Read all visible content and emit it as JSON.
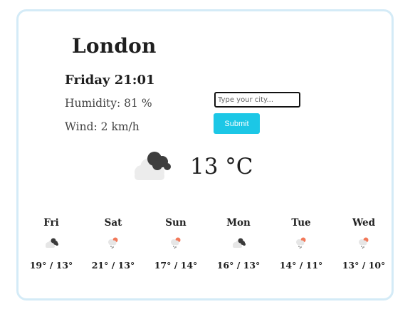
{
  "current": {
    "city": "London",
    "day_time": "Friday 21:01",
    "humidity": "Humidity: 81 %",
    "wind": "Wind: 2 km/h",
    "temperature": "13 °C",
    "icon": "cloudy-night-icon"
  },
  "search": {
    "placeholder": "Type your city...",
    "value": "",
    "submit_label": "Submit",
    "submit_color": "#1cc7e6"
  },
  "forecast": [
    {
      "day": "Fri",
      "icon": "cloudy-night-icon",
      "range": "19° / 13°"
    },
    {
      "day": "Sat",
      "icon": "sun-rain-icon",
      "range": "21° / 13°"
    },
    {
      "day": "Sun",
      "icon": "sun-rain-icon",
      "range": "17° / 14°"
    },
    {
      "day": "Mon",
      "icon": "cloudy-night-icon",
      "range": "16° / 13°"
    },
    {
      "day": "Tue",
      "icon": "sun-rain-icon",
      "range": "14° / 11°"
    },
    {
      "day": "Wed",
      "icon": "sun-rain-icon",
      "range": "13° / 10°"
    }
  ]
}
